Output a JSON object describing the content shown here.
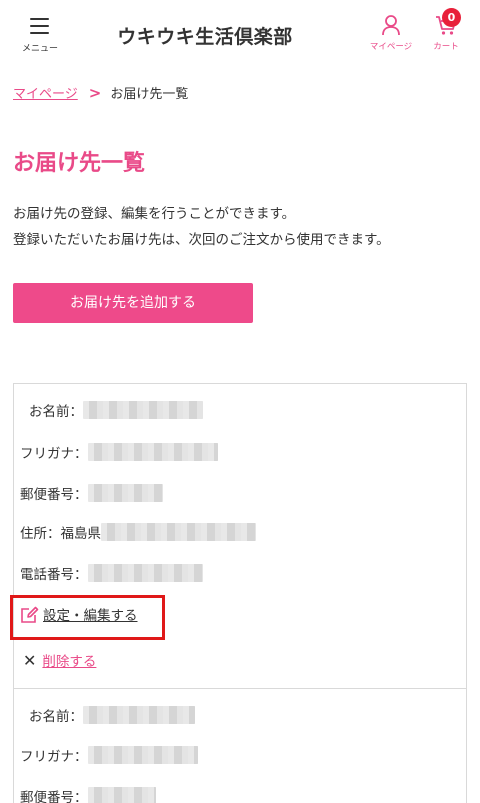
{
  "header": {
    "menu_label": "メニュー",
    "logo_text": "ウキウキ生活倶楽部",
    "mypage_label": "マイページ",
    "cart_label": "カート",
    "cart_count": "0"
  },
  "breadcrumb": {
    "link": "マイページ",
    "separator": ">",
    "current": "お届け先一覧"
  },
  "page": {
    "title": "お届け先一覧",
    "intro_line1": "お届け先の登録、編集を行うことができます。",
    "intro_line2": "登録いただいたお届け先は、次回のご注文から使用できます。",
    "add_button": "お届け先を追加する"
  },
  "addresses": [
    {
      "name_label": "お名前：",
      "kana_label": "フリガナ：",
      "zip_label": "郵便番号：",
      "address_label": "住所：福島県",
      "phone_label": "電話番号：",
      "edit_label": "設定・編集する",
      "delete_label": "削除する"
    },
    {
      "name_label": "お名前：",
      "kana_label": "フリガナ：",
      "zip_label": "郵便番号："
    }
  ],
  "colors": {
    "accent": "#e94a88",
    "button": "#ee4a8a",
    "badge": "#e8203a",
    "highlight": "#e01818"
  }
}
